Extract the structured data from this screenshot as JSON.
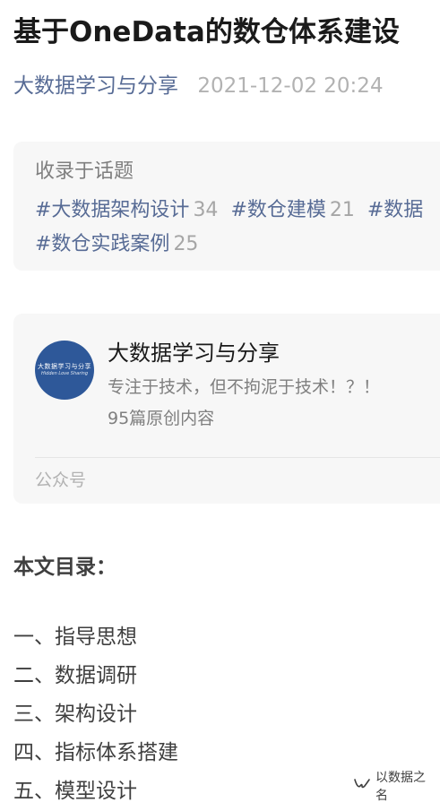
{
  "article": {
    "title": "基于OneData的数仓体系建设",
    "author": "大数据学习与分享",
    "time": "2021-12-02 20:24"
  },
  "topics": {
    "header": "收录于话题",
    "tags": [
      {
        "name": "#大数据架构设计",
        "count": "34"
      },
      {
        "name": "#数仓建模",
        "count": "21"
      },
      {
        "name": "#数据",
        "count": ""
      },
      {
        "name": "#数仓实践案例",
        "count": "25"
      }
    ]
  },
  "account": {
    "avatar_logo": "大数据学习与分享",
    "avatar_sub": "Hidden Love Sharing",
    "name": "大数据学习与分享",
    "description": "专注于技术，但不拘泥于技术！？！",
    "articles": "95篇原创内容",
    "type": "公众号"
  },
  "toc": {
    "title": "本文目录：",
    "items": [
      "一、指导思想",
      "二、数据调研",
      "三、架构设计",
      "四、指标体系搭建",
      "五、模型设计"
    ]
  },
  "watermark": {
    "icon": "wechat-channel-icon",
    "text": "以数据之名"
  }
}
